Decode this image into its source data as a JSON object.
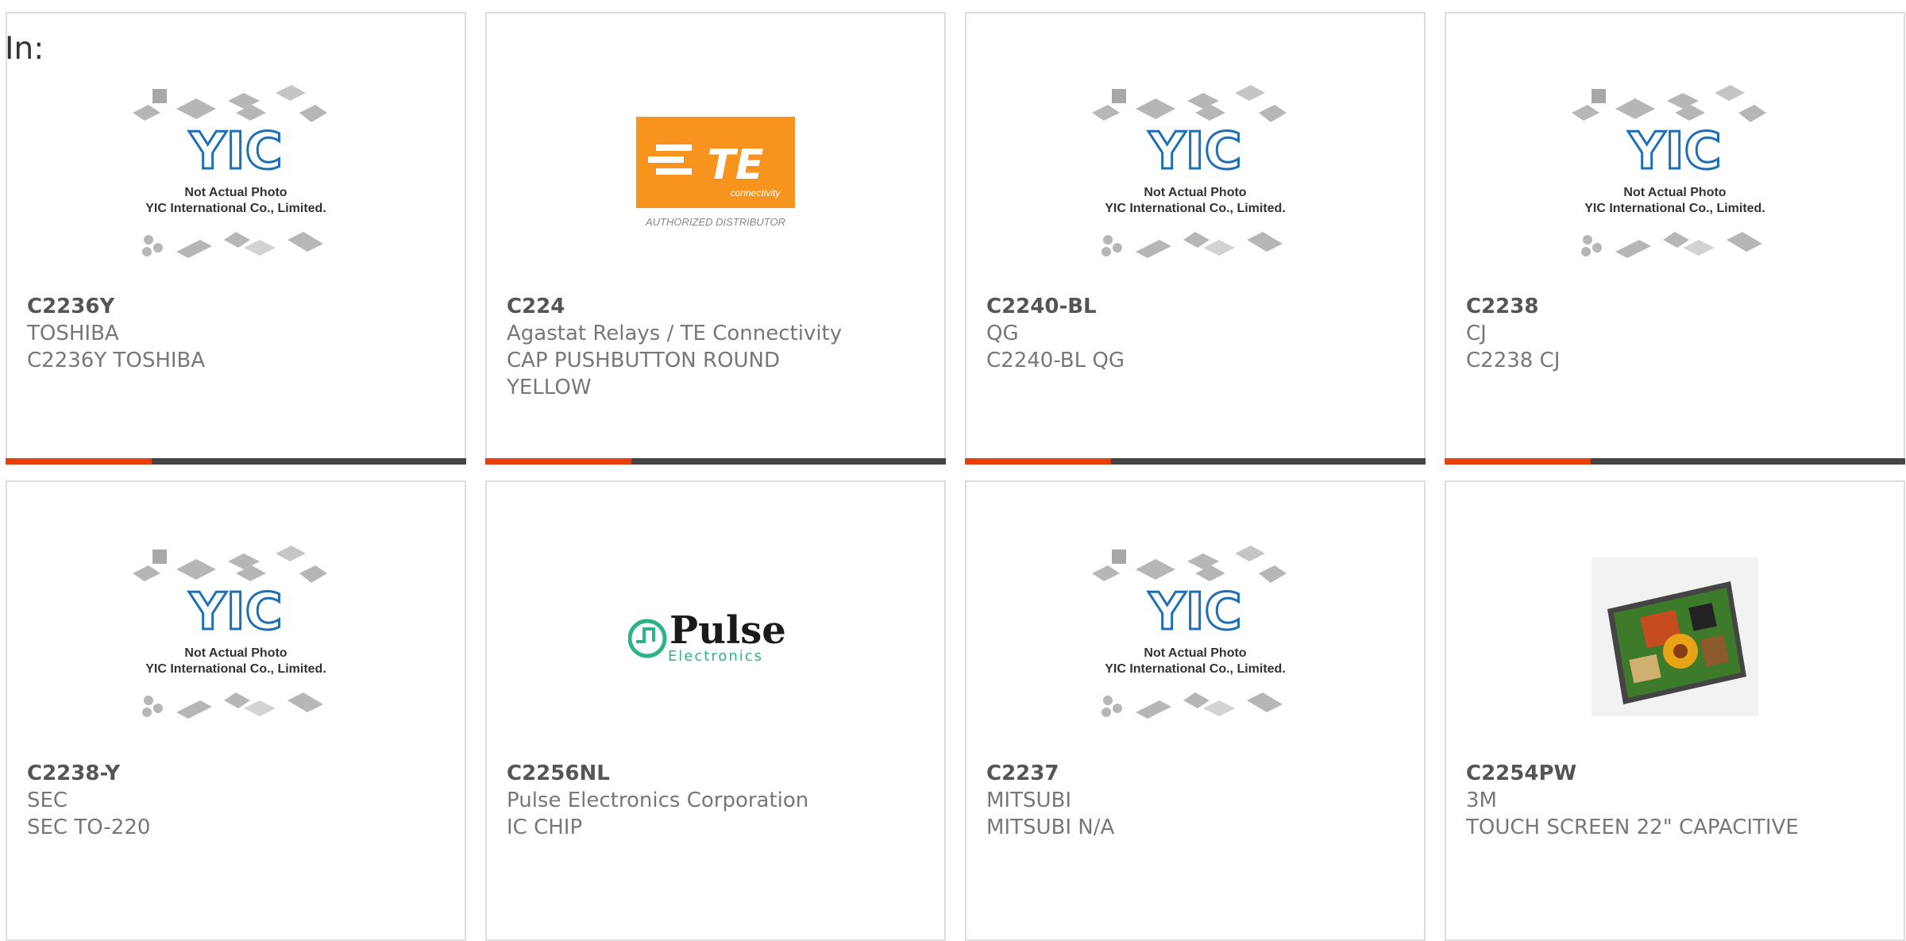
{
  "header": {
    "label": "In:"
  },
  "colors": {
    "accent": "#e8400c",
    "bar": "#444444",
    "border": "#dddddd"
  },
  "placeholder": {
    "line1": "Not Actual Photo",
    "line2": "YIC International Co., Limited.",
    "logo": "YIC"
  },
  "te_logo": {
    "mark": "TE",
    "sub": "connectivity",
    "caption": "AUTHORIZED DISTRIBUTOR"
  },
  "pulse_logo": {
    "word": "Pulse",
    "sub": "Electronics"
  },
  "products": [
    {
      "part": "C2236Y",
      "line1": "TOSHIBA",
      "line2": "C2236Y TOSHIBA",
      "line3": "",
      "image": "yic-placeholder"
    },
    {
      "part": "C224",
      "line1": "Agastat Relays / TE Connectivity",
      "line2": "CAP PUSHBUTTON ROUND",
      "line3": "YELLOW",
      "image": "te-logo"
    },
    {
      "part": "C2240-BL",
      "line1": "QG",
      "line2": "C2240-BL QG",
      "line3": "",
      "image": "yic-placeholder"
    },
    {
      "part": "C2238",
      "line1": "CJ",
      "line2": "C2238 CJ",
      "line3": "",
      "image": "yic-placeholder"
    },
    {
      "part": "C2238-Y",
      "line1": "SEC",
      "line2": "SEC TO-220",
      "line3": "",
      "image": "yic-placeholder"
    },
    {
      "part": "C2256NL",
      "line1": "Pulse Electronics Corporation",
      "line2": "IC CHIP",
      "line3": "",
      "image": "pulse-logo"
    },
    {
      "part": "C2237",
      "line1": "MITSUBI",
      "line2": "MITSUBI N/A",
      "line3": "",
      "image": "yic-placeholder"
    },
    {
      "part": "C2254PW",
      "line1": "3M",
      "line2": "TOUCH SCREEN 22\" CAPACITIVE",
      "line3": "",
      "image": "touchscreen-photo"
    }
  ]
}
